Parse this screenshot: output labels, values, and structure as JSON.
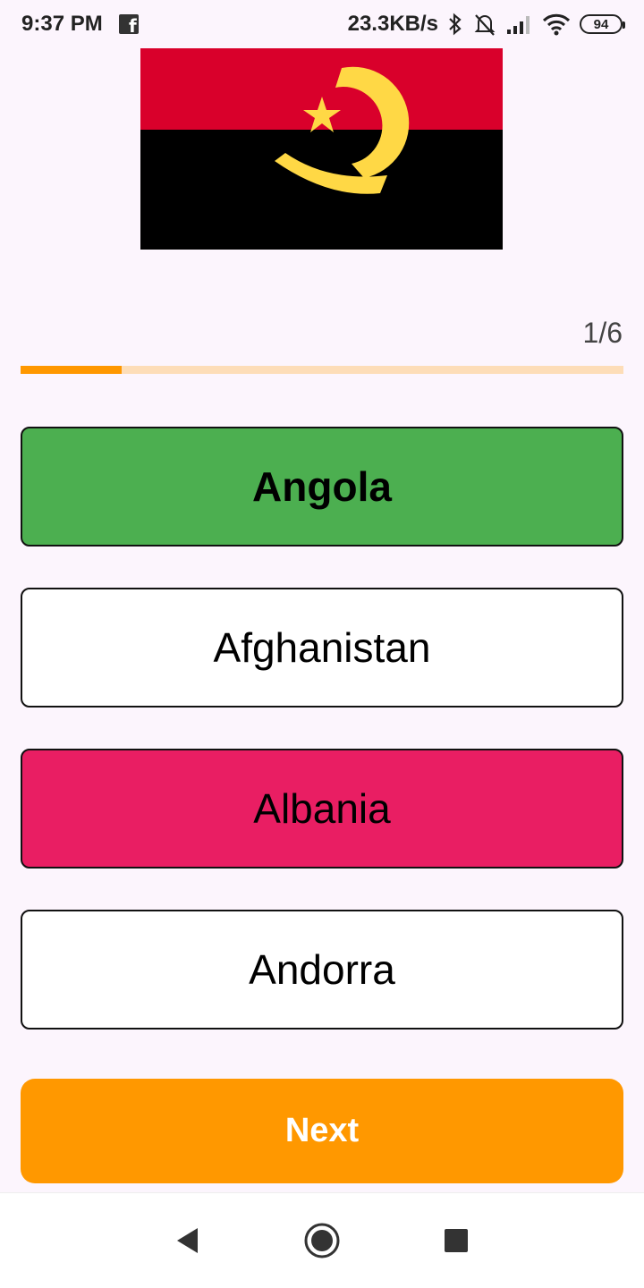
{
  "status_bar": {
    "time": "9:37 PM",
    "notification_icon": "facebook-icon",
    "net_speed": "23.3KB/s",
    "icons": [
      "bluetooth-icon",
      "mute-icon",
      "signal-icon",
      "wifi-icon"
    ],
    "battery": "94"
  },
  "quiz": {
    "flag_icon": "angola-flag",
    "progress_label": "1/6",
    "progress_fraction": 0.167,
    "options": [
      {
        "label": "Angola",
        "state": "correct",
        "color": "#4CAF50"
      },
      {
        "label": "Afghanistan",
        "state": "neutral",
        "color": "#FFFFFF"
      },
      {
        "label": "Albania",
        "state": "wrong",
        "color": "#E91E63"
      },
      {
        "label": "Andorra",
        "state": "neutral",
        "color": "#FFFFFF"
      }
    ],
    "next_label": "Next"
  },
  "colors": {
    "accent": "#FF9800",
    "progress_track": "#FDDDB8",
    "background": "#FCF5FD"
  },
  "nav_bar": {
    "buttons": [
      "back-icon",
      "home-icon",
      "recents-icon"
    ]
  }
}
